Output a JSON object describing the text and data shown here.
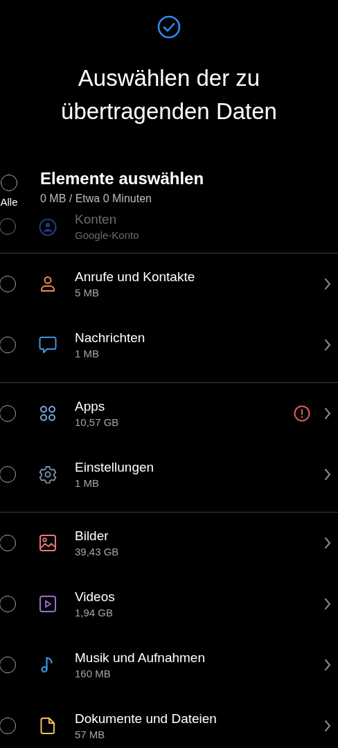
{
  "title": "Auswählen der zu übertragenden Daten",
  "select_all": {
    "label": "Elemente auswählen",
    "summary": "0 MB / Etwa 0 Minuten",
    "checkbox_label": "Alle",
    "checked": false
  },
  "groups": [
    {
      "items": [
        {
          "kind": "account",
          "color": "#1e3a78",
          "label": "Konten",
          "detail": "Google-Konto",
          "checked": false,
          "disabled": true,
          "warning": false,
          "chevron": false
        }
      ]
    },
    {
      "items": [
        {
          "kind": "person",
          "color": "#f08a4b",
          "label": "Anrufe und Kontakte",
          "detail": "5 MB",
          "checked": false,
          "disabled": false,
          "warning": false,
          "chevron": true
        },
        {
          "kind": "message",
          "color": "#3d95e0",
          "label": "Nachrichten",
          "detail": "1 MB",
          "checked": false,
          "disabled": false,
          "warning": false,
          "chevron": true
        }
      ]
    },
    {
      "items": [
        {
          "kind": "apps",
          "color": "#7aa7e6",
          "label": "Apps",
          "detail": "10,57 GB",
          "checked": false,
          "disabled": false,
          "warning": true,
          "chevron": true
        },
        {
          "kind": "gear",
          "color": "#7d96b8",
          "label": "Einstellungen",
          "detail": "1 MB",
          "checked": false,
          "disabled": false,
          "warning": false,
          "chevron": true
        }
      ]
    },
    {
      "items": [
        {
          "kind": "image",
          "color": "#e8767a",
          "label": "Bilder",
          "detail": "39,43 GB",
          "checked": false,
          "disabled": false,
          "warning": false,
          "chevron": true
        },
        {
          "kind": "video",
          "color": "#9a6fd6",
          "label": "Videos",
          "detail": "1,94 GB",
          "checked": false,
          "disabled": false,
          "warning": false,
          "chevron": true
        },
        {
          "kind": "music",
          "color": "#3d95e0",
          "label": "Musik und Aufnahmen",
          "detail": "160 MB",
          "checked": false,
          "disabled": false,
          "warning": false,
          "chevron": true
        },
        {
          "kind": "document",
          "color": "#f0c060",
          "label": "Dokumente und Dateien",
          "detail": "57 MB",
          "checked": false,
          "disabled": false,
          "warning": false,
          "chevron": true
        }
      ]
    }
  ]
}
